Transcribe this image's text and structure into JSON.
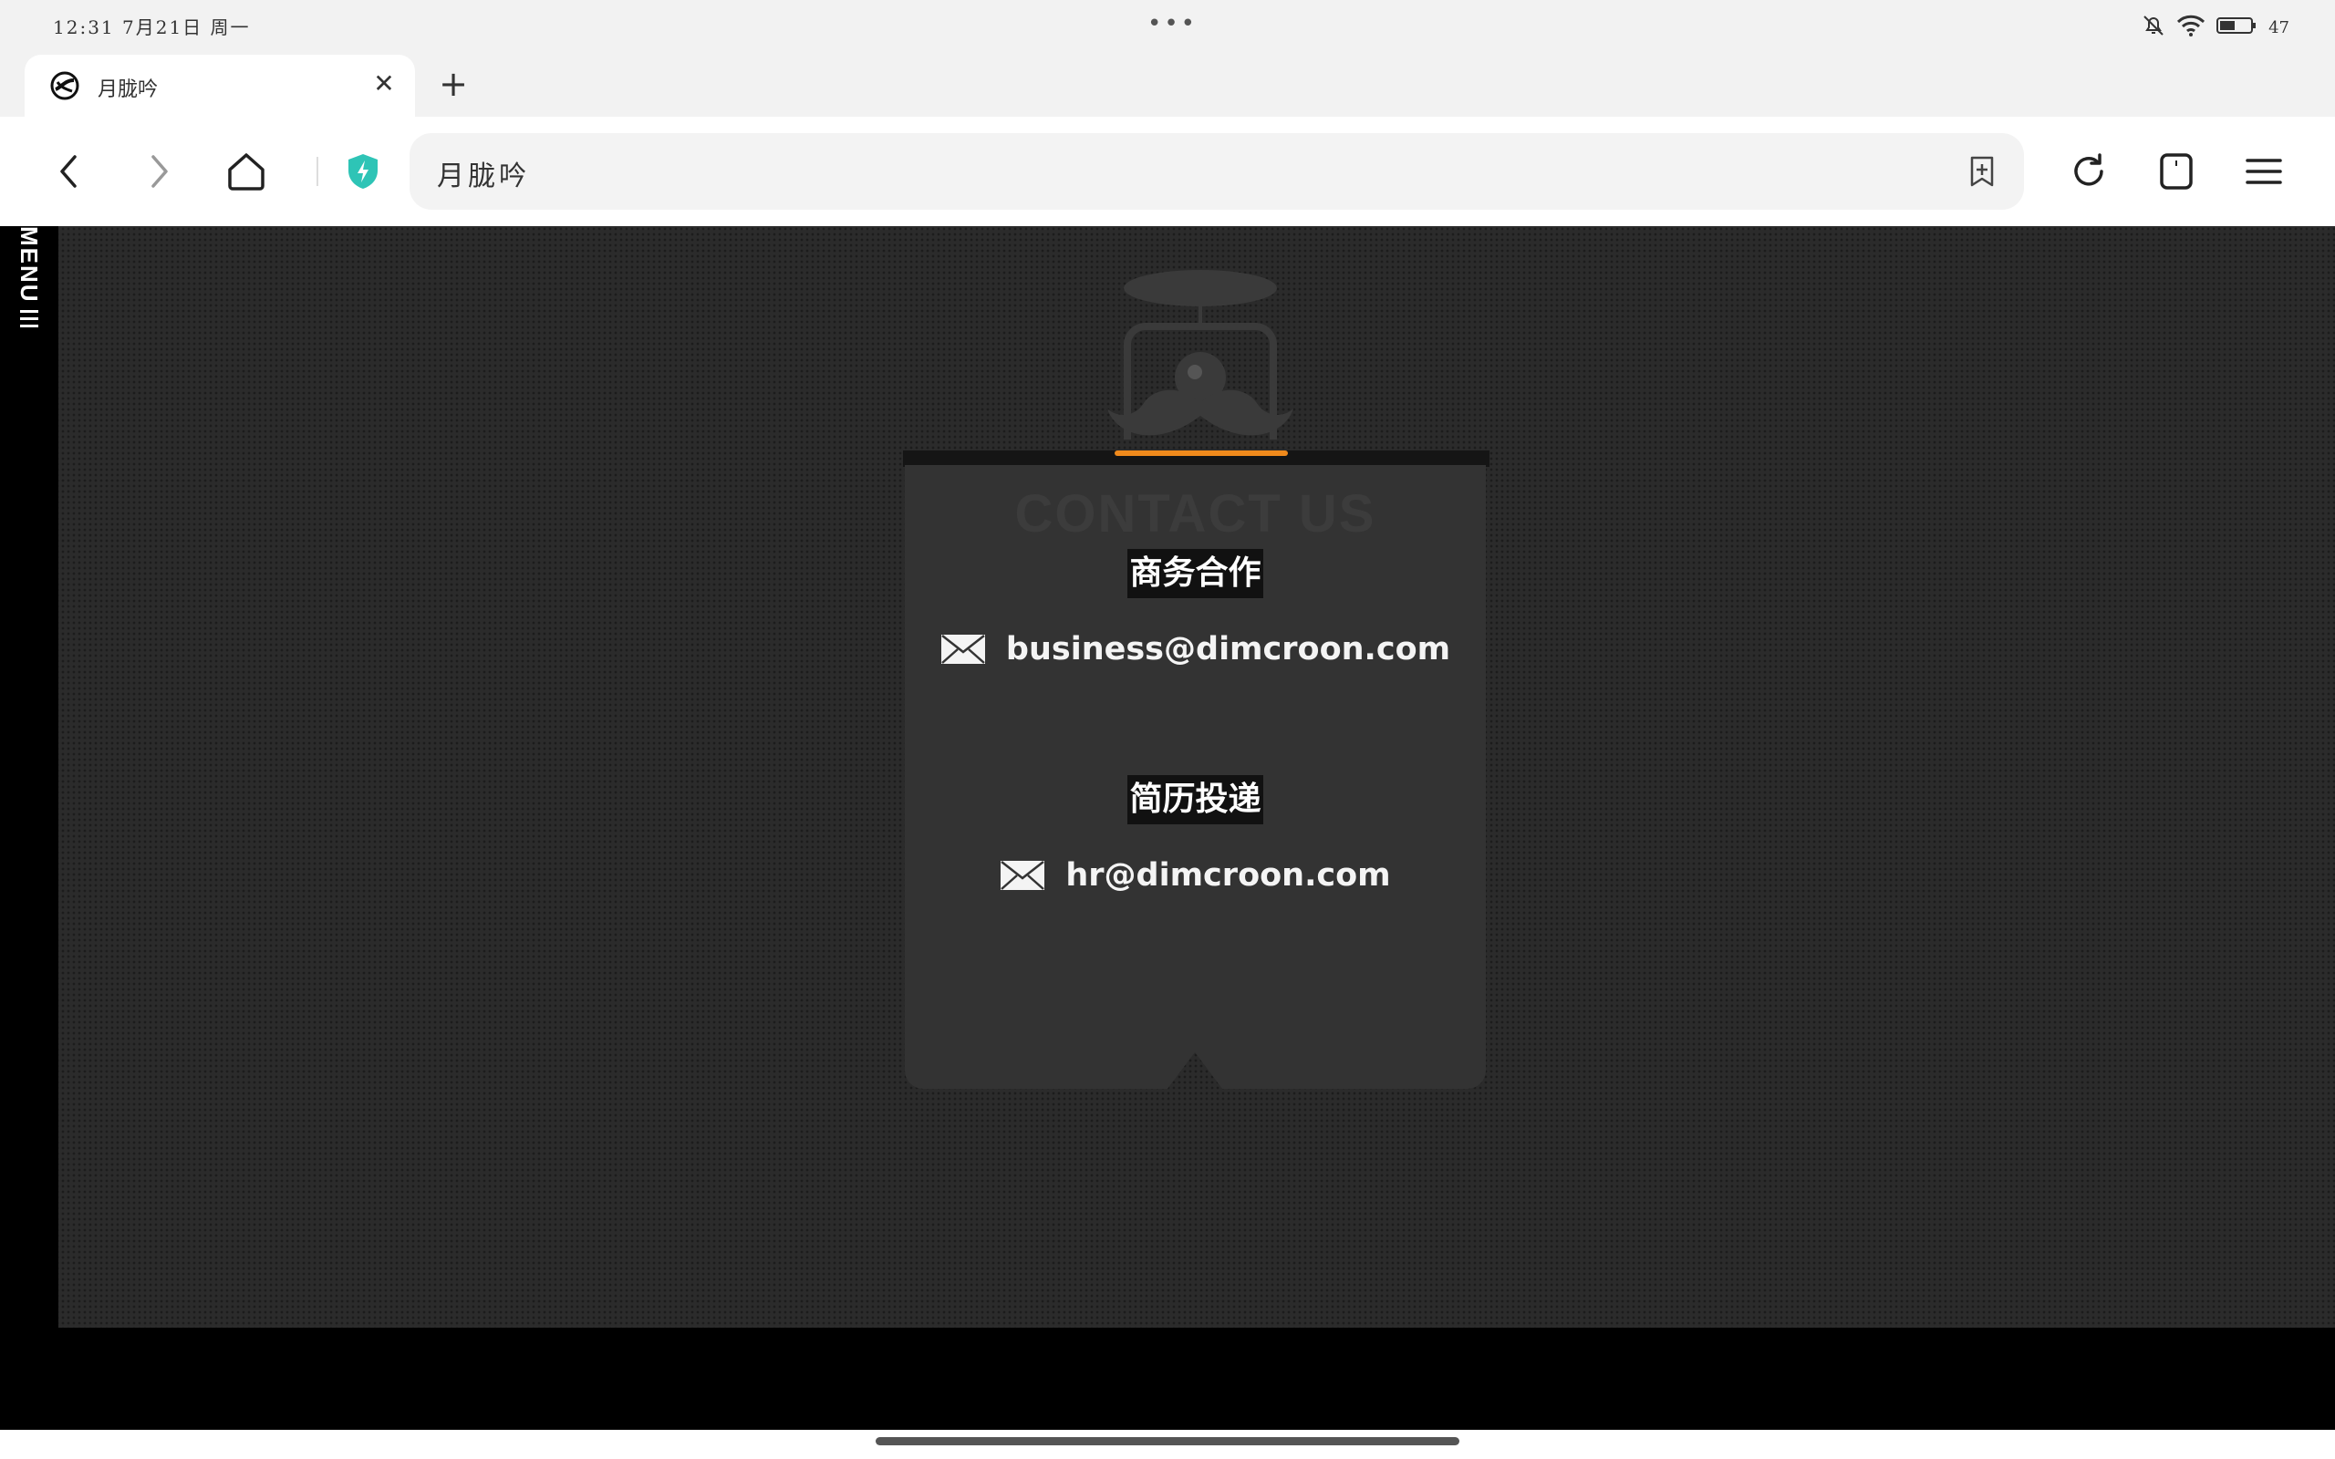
{
  "status_bar": {
    "time": "12:31 7月21日 周一",
    "more_dots": "•••",
    "battery_percent": "47"
  },
  "tab": {
    "title": "月胧吟",
    "close_glyph": "✕",
    "new_tab_glyph": "+"
  },
  "toolbar": {
    "url_text": "月胧吟"
  },
  "side_menu": {
    "label": "MENU"
  },
  "contact": {
    "ghost_heading": "CONTACT US",
    "sections": [
      {
        "title": "商务合作",
        "email": "business@dimcroon.com"
      },
      {
        "title": "简历投递",
        "email": "hr@dimcroon.com"
      }
    ]
  },
  "colors": {
    "accent": "#f08a1c",
    "security_shield": "#2ec4b6",
    "page_bg": "#2b2b2b",
    "card_bg": "#333333"
  }
}
